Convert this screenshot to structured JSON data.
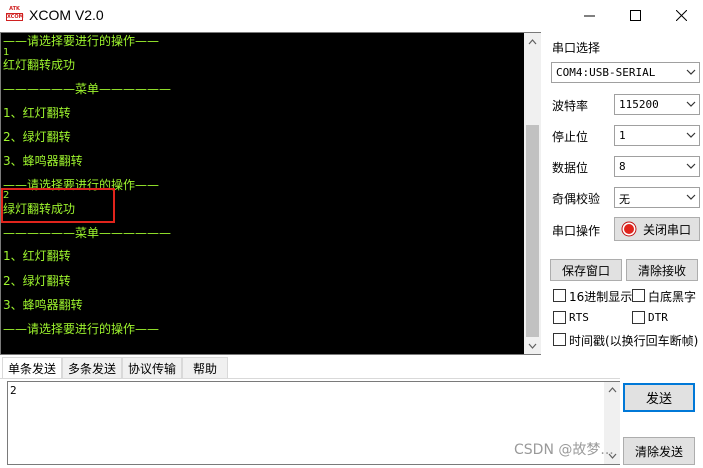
{
  "window": {
    "logo_text_top": "ATK",
    "logo_text_bottom": "XCOM",
    "title": "XCOM V2.0",
    "icons": [
      "minimize-icon",
      "maximize-icon",
      "close-icon"
    ]
  },
  "receive": {
    "lines": [
      "——请选择要进行的操作——",
      "1",
      "红灯翻转成功",
      "——————菜单——————",
      "1、红灯翻转",
      "2、绿灯翻转",
      "3、蜂鸣器翻转",
      "——请选择要进行的操作——",
      "2",
      "绿灯翻转成功",
      "——————菜单——————",
      "1、红灯翻转",
      "2、绿灯翻转",
      "3、蜂鸣器翻转",
      "——请选择要进行的操作——"
    ],
    "text_color": "#9ef52e",
    "background": "#000000",
    "highlight_color": "#e0241c"
  },
  "settings": {
    "port_label": "串口选择",
    "port_value": "COM4:USB-SERIAL",
    "baud_label": "波特率",
    "baud_value": "115200",
    "stop_label": "停止位",
    "stop_value": "1",
    "data_label": "数据位",
    "data_value": "8",
    "parity_label": "奇偶校验",
    "parity_value": "无",
    "operation_label": "串口操作",
    "close_port_label": "关闭串口",
    "port_status_color": "#e0241c"
  },
  "actions": {
    "save_window": "保存窗口",
    "clear_receive": "清除接收"
  },
  "options": {
    "hex_display": "16进制显示",
    "white_black": "白底黑字",
    "rts": "RTS",
    "dtr": "DTR",
    "timestamp": "时间戳(以换行回车断帧)"
  },
  "tabs": [
    "单条发送",
    "多条发送",
    "协议传输",
    "帮助"
  ],
  "send": {
    "text": "2",
    "send_label": "发送",
    "clear_send_label": "清除发送"
  },
  "watermark": "CSDN @故梦..."
}
